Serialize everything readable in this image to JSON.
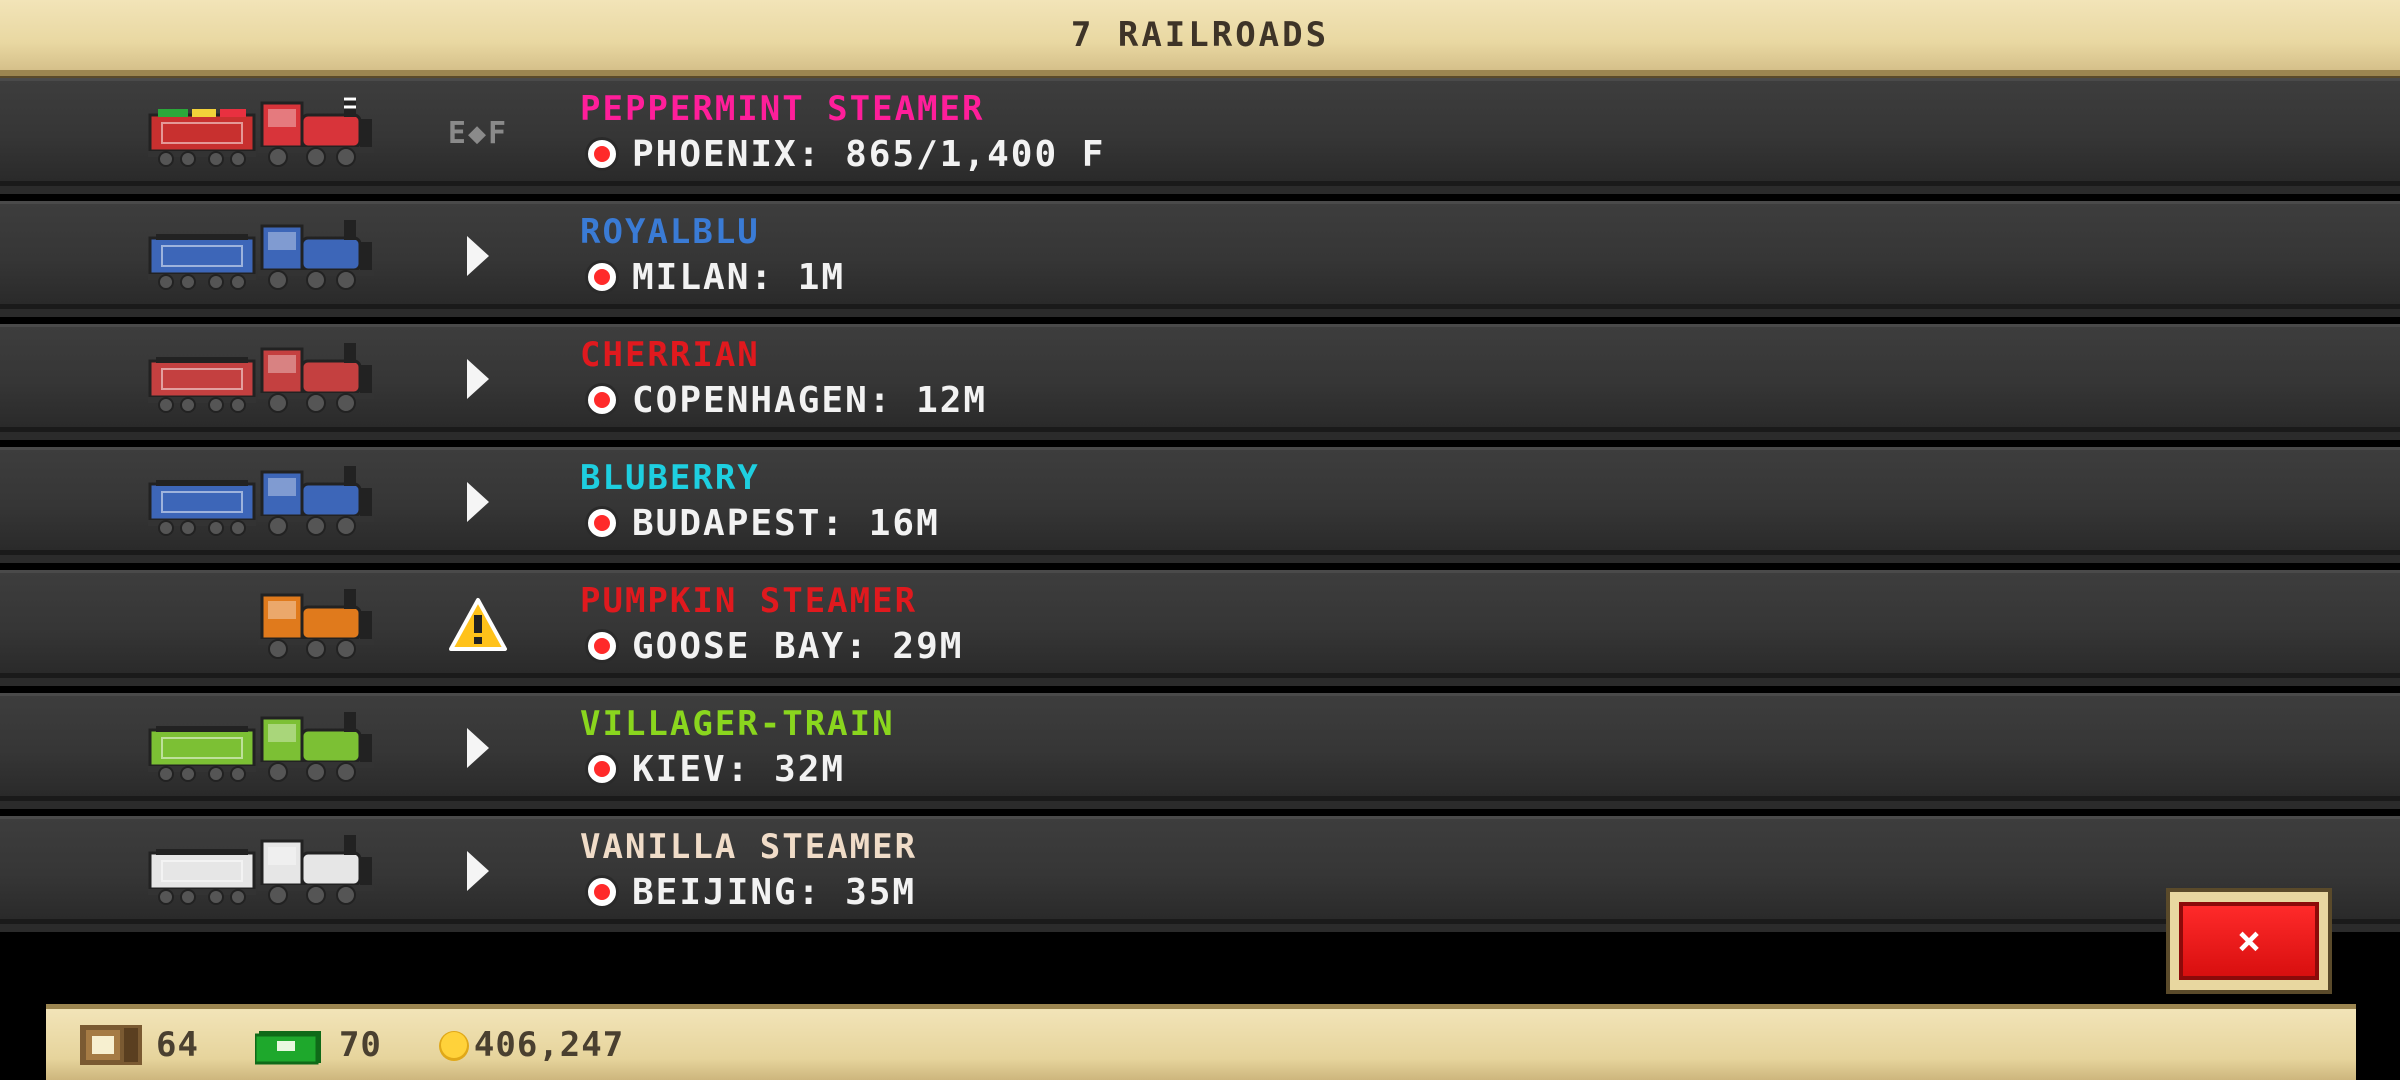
{
  "header": {
    "title": "7 RAILROADS"
  },
  "trains": [
    {
      "name": "PEPPERMINT STEAMER",
      "name_color": "#ff1e9a",
      "destination": "PHOENIX: 865/1,400 F",
      "status": "fuel",
      "status_text": "E◆F",
      "tender_color": "#c8302f",
      "engine_color": "#d8343a",
      "has_tender": true,
      "decor": "candy"
    },
    {
      "name": "ROYALBLU",
      "name_color": "#3a7bd5",
      "destination": "MILAN: 1M",
      "status": "play",
      "tender_color": "#3d66b8",
      "engine_color": "#3d66b8",
      "has_tender": true
    },
    {
      "name": "CHERRIAN",
      "name_color": "#e0191e",
      "destination": "COPENHAGEN: 12M",
      "status": "play",
      "tender_color": "#c44040",
      "engine_color": "#c44040",
      "has_tender": true
    },
    {
      "name": "BLUBERRY",
      "name_color": "#1ecfe0",
      "destination": "BUDAPEST: 16M",
      "status": "play",
      "tender_color": "#3d66b8",
      "engine_color": "#3d66b8",
      "has_tender": true
    },
    {
      "name": "PUMPKIN STEAMER",
      "name_color": "#e0191e",
      "destination": "GOOSE BAY: 29M",
      "status": "warning",
      "tender_color": "#e07a1c",
      "engine_color": "#e07a1c",
      "has_tender": false
    },
    {
      "name": "VILLAGER-TRAIN",
      "name_color": "#8ad61e",
      "destination": "KIEV: 32M",
      "status": "play",
      "tender_color": "#7cc034",
      "engine_color": "#7cc034",
      "has_tender": true
    },
    {
      "name": "VANILLA STEAMER",
      "name_color": "#f0dcc8",
      "destination": "BEIJING: 35M",
      "status": "play",
      "tender_color": "#e6e6e6",
      "engine_color": "#e6e6e6",
      "has_tender": true
    }
  ],
  "close_button": {
    "label": "×"
  },
  "footer": {
    "crates": "64",
    "cash": "70",
    "coins": "406,247"
  }
}
